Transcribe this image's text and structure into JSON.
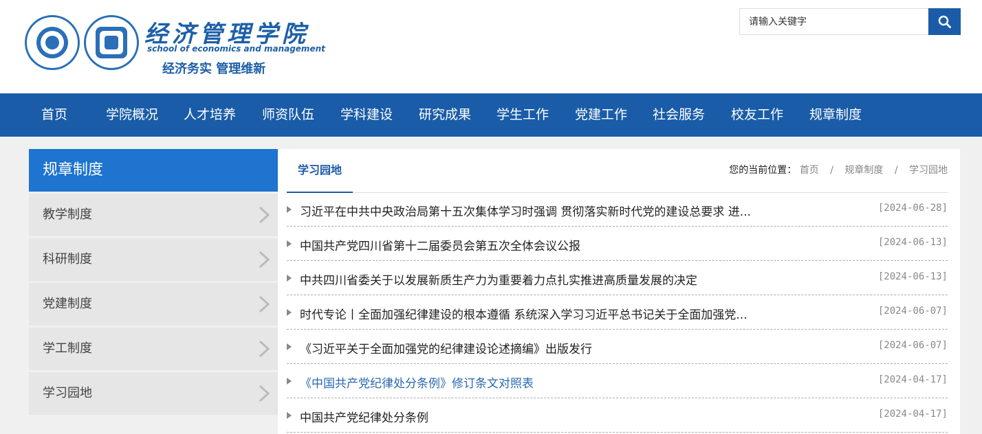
{
  "header": {
    "brand_cn": "经济管理学院",
    "brand_en": "school of economics and management",
    "motto": "经济务实 管理维新"
  },
  "search": {
    "placeholder": "请输入关键字"
  },
  "nav": [
    "首页",
    "学院概况",
    "人才培养",
    "师资队伍",
    "学科建设",
    "研究成果",
    "学生工作",
    "党建工作",
    "社会服务",
    "校友工作",
    "规章制度"
  ],
  "sidebar": {
    "title": "规章制度",
    "items": [
      "教学制度",
      "科研制度",
      "党建制度",
      "学工制度",
      "学习园地"
    ]
  },
  "content": {
    "tab": "学习园地",
    "breadcrumb": {
      "label": "您的当前位置：",
      "items": [
        "首页",
        "规章制度",
        "学习园地"
      ],
      "separator": "/"
    },
    "articles": [
      {
        "title": "习近平在中共中央政治局第十五次集体学习时强调 贯彻落实新时代党的建设总要求 进...",
        "date": "[2024-06-28]"
      },
      {
        "title": "中国共产党四川省第十二届委员会第五次全体会议公报",
        "date": "[2024-06-13]"
      },
      {
        "title": "中共四川省委关于以发展新质生产力为重要着力点扎实推进高质量发展的决定",
        "date": "[2024-06-13]"
      },
      {
        "title": "时代专论丨全面加强纪律建设的根本遵循 系统深入学习习近平总书记关于全面加强党...",
        "date": "[2024-06-07]"
      },
      {
        "title": "《习近平关于全面加强党的纪律建设论述摘编》出版发行",
        "date": "[2024-06-07]"
      },
      {
        "title": "《中国共产党纪律处分条例》修订条文对照表",
        "date": "[2024-04-17]"
      },
      {
        "title": "中国共产党纪律处分条例",
        "date": "[2024-04-17]"
      }
    ]
  },
  "colors": {
    "primary": "#1a5ca8",
    "sidebar_title": "#1e74cf",
    "highlight_link": "#2a68b0"
  }
}
